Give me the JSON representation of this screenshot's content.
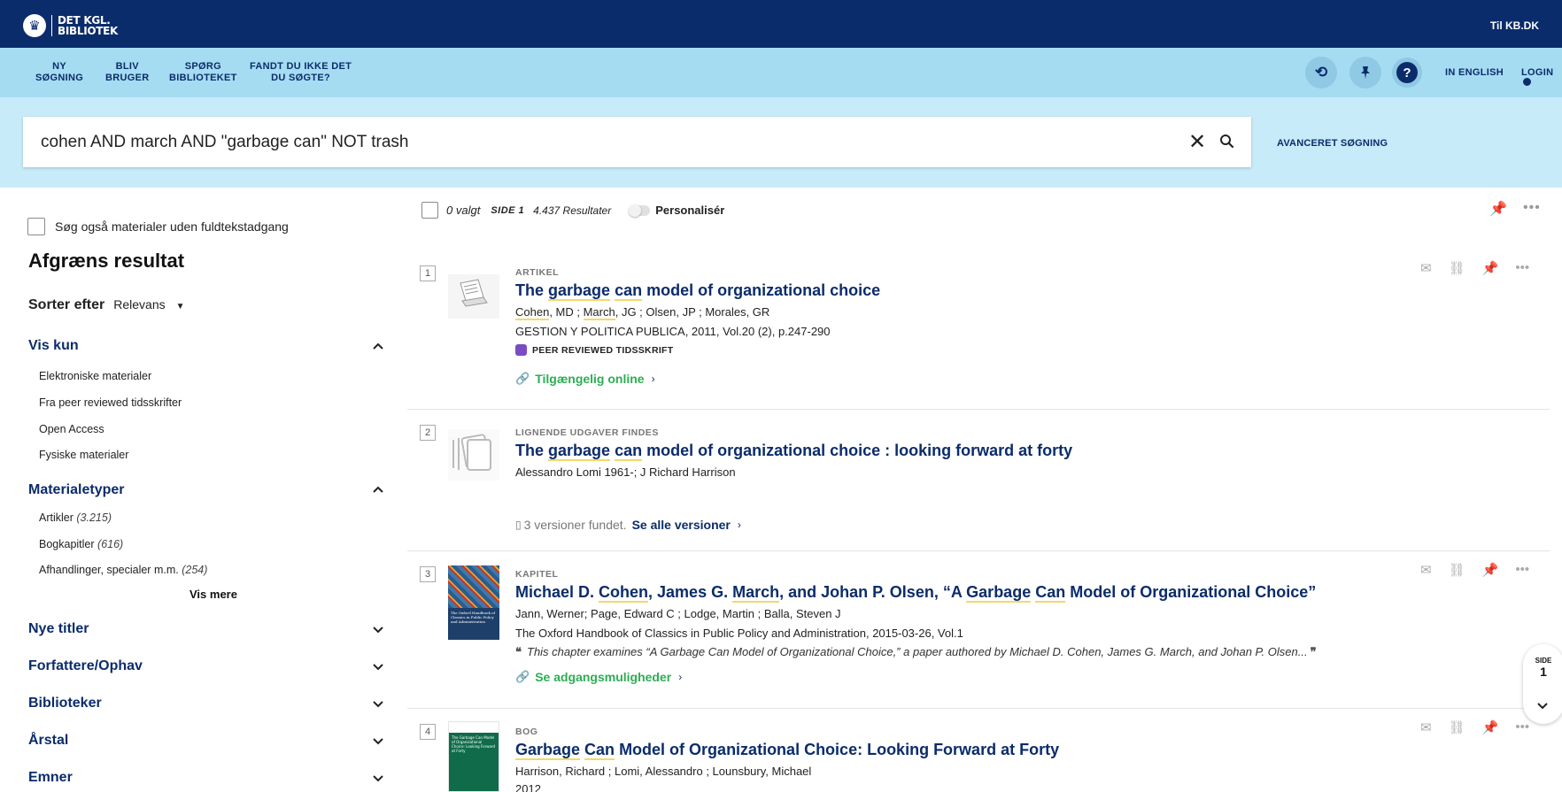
{
  "header": {
    "logo_line1": "DET KGL.",
    "logo_line2": "BIBLIOTEK",
    "to_kb": "Til KB.DK"
  },
  "nav": {
    "new_search_1": "NY",
    "new_search_2": "SØGNING",
    "become_user_1": "BLIV",
    "become_user_2": "BRUGER",
    "ask_1": "SPØRG",
    "ask_2": "BIBLIOTEKET",
    "not_found_1": "FANDT DU IKKE DET",
    "not_found_2": "DU SØGTE?",
    "history_icon": "history-icon",
    "pin_icon": "pin-icon",
    "help_icon": "help-icon",
    "english": "IN ENGLISH",
    "login": "LOGIN"
  },
  "search": {
    "query": "cohen AND march AND \"garbage can\" NOT trash",
    "advanced": "AVANCERET SØGNING"
  },
  "sidebar": {
    "fulltext_label": "Søg også materialer uden fuldtekstadgang",
    "refine_title": "Afgræns resultat",
    "sort_label": "Sorter efter",
    "sort_value": "Relevans",
    "vis_kun": {
      "heading": "Vis kun",
      "options": [
        "Elektroniske materialer",
        "Fra peer reviewed tidsskrifter",
        "Open Access",
        "Fysiske materialer"
      ]
    },
    "materialetyper": {
      "heading": "Materialetyper",
      "options": [
        {
          "label": "Artikler",
          "count": "(3.215)"
        },
        {
          "label": "Bogkapitler",
          "count": "(616)"
        },
        {
          "label": "Afhandlinger, specialer m.m.",
          "count": "(254)"
        }
      ],
      "more": "Vis mere"
    },
    "collapsed": [
      "Nye titler",
      "Forfattere/Ophav",
      "Biblioteker",
      "Årstal",
      "Emner"
    ]
  },
  "results_header": {
    "selected": "0 valgt",
    "page": "SIDE 1",
    "count": "4.437 Resultater",
    "personalize": "Personalisér"
  },
  "results": [
    {
      "num": "1",
      "type": "ARTIKEL",
      "title_parts": [
        "The ",
        "garbage",
        " ",
        "can",
        " model of organizational choice"
      ],
      "authors_parts": [
        "Cohen",
        ", MD ; ",
        "March",
        ", JG ; Olsen, JP ; Morales, GR"
      ],
      "source": "GESTION Y POLITICA PUBLICA, 2011, Vol.20 (2), p.247-290",
      "peer": "PEER REVIEWED TIDSSKRIFT",
      "access": "Tilgængelig online"
    },
    {
      "num": "2",
      "type": "LIGNENDE UDGAVER FINDES",
      "title_parts": [
        "The ",
        "garbage",
        " ",
        "can",
        " model of organizational choice : looking forward at forty"
      ],
      "authors": "Alessandro Lomi 1961-; J Richard Harrison",
      "versions": "3 versioner fundet.",
      "versions_link": "Se alle versioner"
    },
    {
      "num": "3",
      "type": "KAPITEL",
      "title_parts": [
        "Michael D. ",
        "Cohen",
        ", James G. ",
        "March",
        ", and Johan P. Olsen, “A ",
        "Garbage",
        " ",
        "Can",
        " Model of Organizational Choice”"
      ],
      "authors": "Jann, Werner; Page, Edward C ; Lodge, Martin ; Balla, Steven J",
      "source": "The Oxford Handbook of Classics in Public Policy and Administration, 2015-03-26, Vol.1",
      "snippet": "This chapter examines “A Garbage Can Model of Organizational Choice,” a paper authored by Michael D. Cohen, James G. March, and Johan P. Olsen...",
      "access": "Se adgangsmuligheder",
      "thumb_text": "The Oxford Handbook of Classics in Public Policy and Administration"
    },
    {
      "num": "4",
      "type": "BOG",
      "title_parts": [
        "",
        "Garbage",
        " ",
        "Can",
        " Model of Organizational Choice: Looking Forward at Forty"
      ],
      "authors": "Harrison, Richard ; Lomi, Alessandro ; Lounsbury, Michael",
      "year": "2012",
      "thumb_text": "The Garbage Can Model of Organizational Choice: Looking Forward at Forty"
    }
  ],
  "page_indicator": {
    "label": "SIDE",
    "number": "1"
  },
  "colors": {
    "navy": "#0b2c6b",
    "sky": "#a6dcf2",
    "light_sky": "#c7ebf9",
    "green": "#2cae53",
    "highlight": "#f3d86b"
  }
}
